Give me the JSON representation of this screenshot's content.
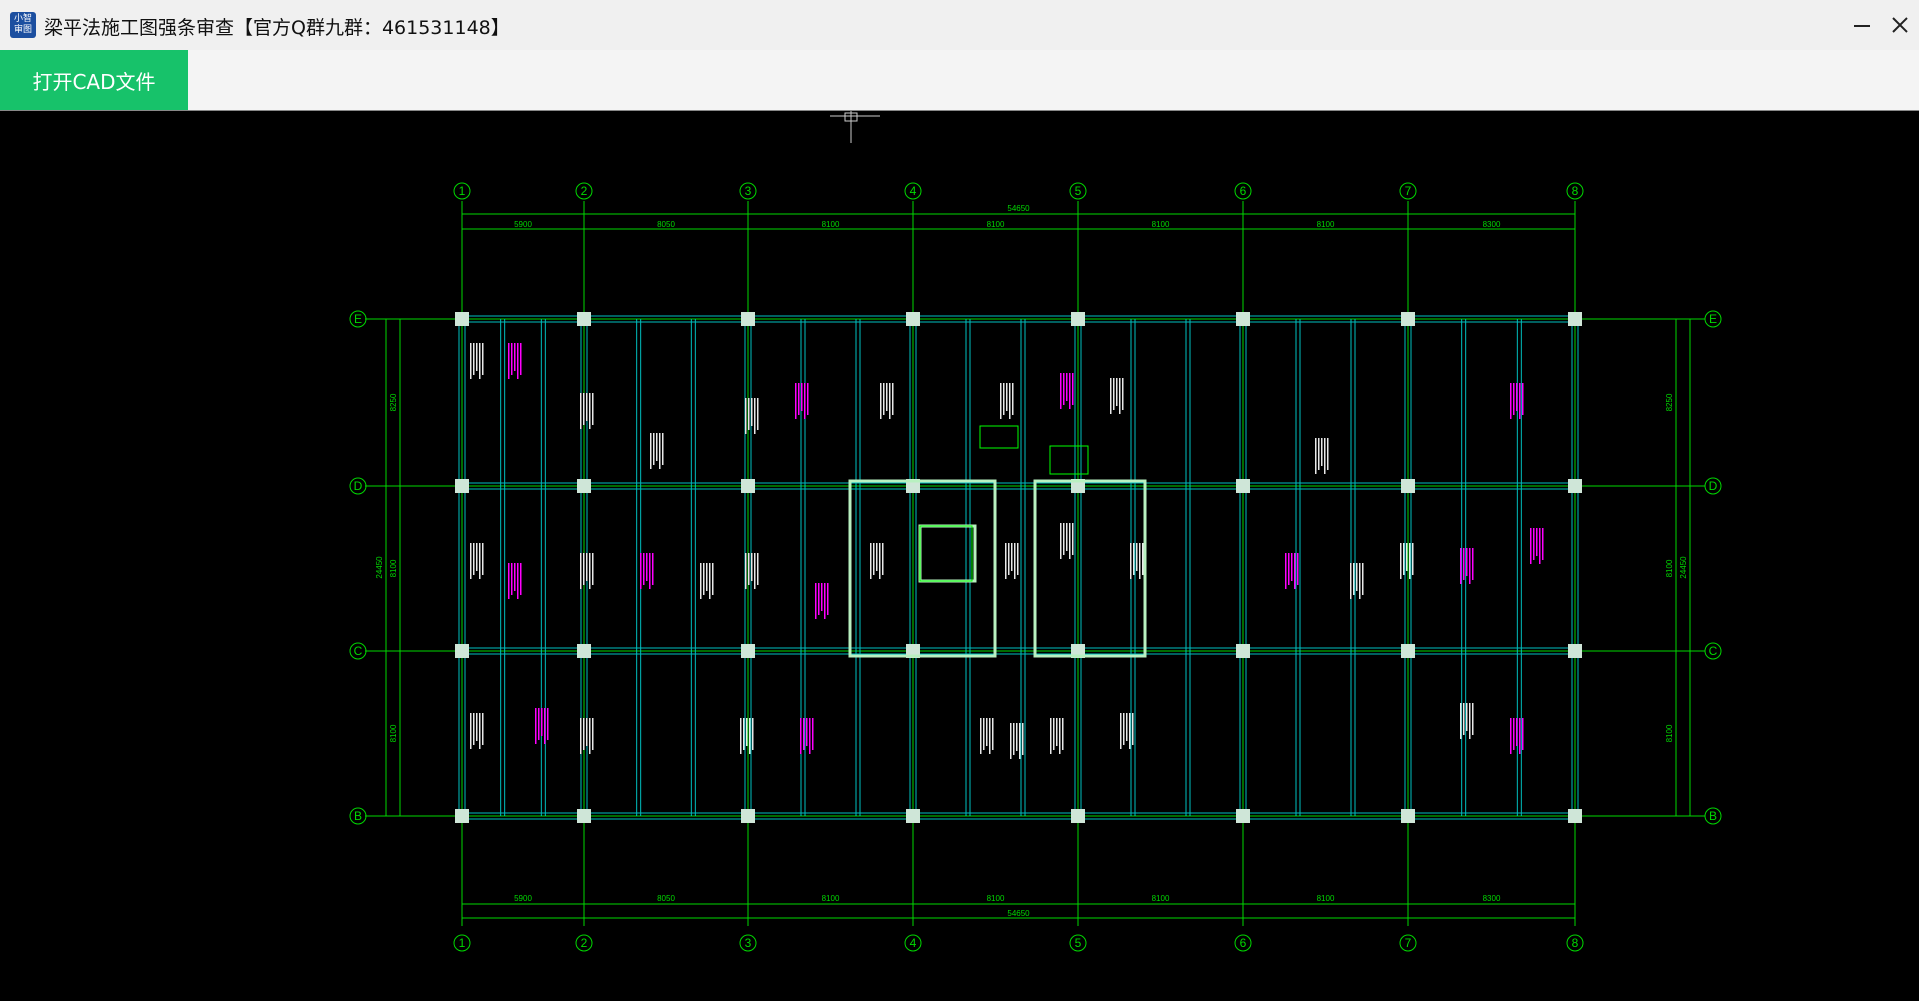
{
  "window": {
    "title": "梁平法施工图强条审查【官方Q群九群：461531148】",
    "icon_line1": "小智",
    "icon_line2": "审图",
    "icon": "app-logo-icon",
    "minimize_icon": "minimize-icon",
    "close_icon": "close-icon"
  },
  "toolbar": {
    "open_label": "打开CAD文件",
    "accent": "#17c26a"
  },
  "drawing": {
    "axes_x": [
      "1",
      "2",
      "3",
      "4",
      "5",
      "6",
      "7",
      "8"
    ],
    "axes_y": [
      "E",
      "D",
      "C",
      "B"
    ],
    "total_dim": "54650",
    "spans_top": [
      "5900",
      "8050",
      "8100",
      "8100",
      "8100",
      "8100",
      "8300"
    ],
    "spans_bottom": [
      "5900",
      "8050",
      "8100",
      "8100",
      "8100",
      "8100",
      "8300"
    ],
    "left_dims": [
      "8250",
      "8100",
      "8100"
    ],
    "left_total": "24450",
    "right_dims": [
      "8250",
      "8100",
      "8100"
    ],
    "right_total": "24450",
    "colors": {
      "grid": "#00d800",
      "beam": "#00bfbf",
      "annot_magenta": "#ff00ff",
      "annot_white": "#e8e8e8",
      "column": "#cfe6d8"
    }
  }
}
